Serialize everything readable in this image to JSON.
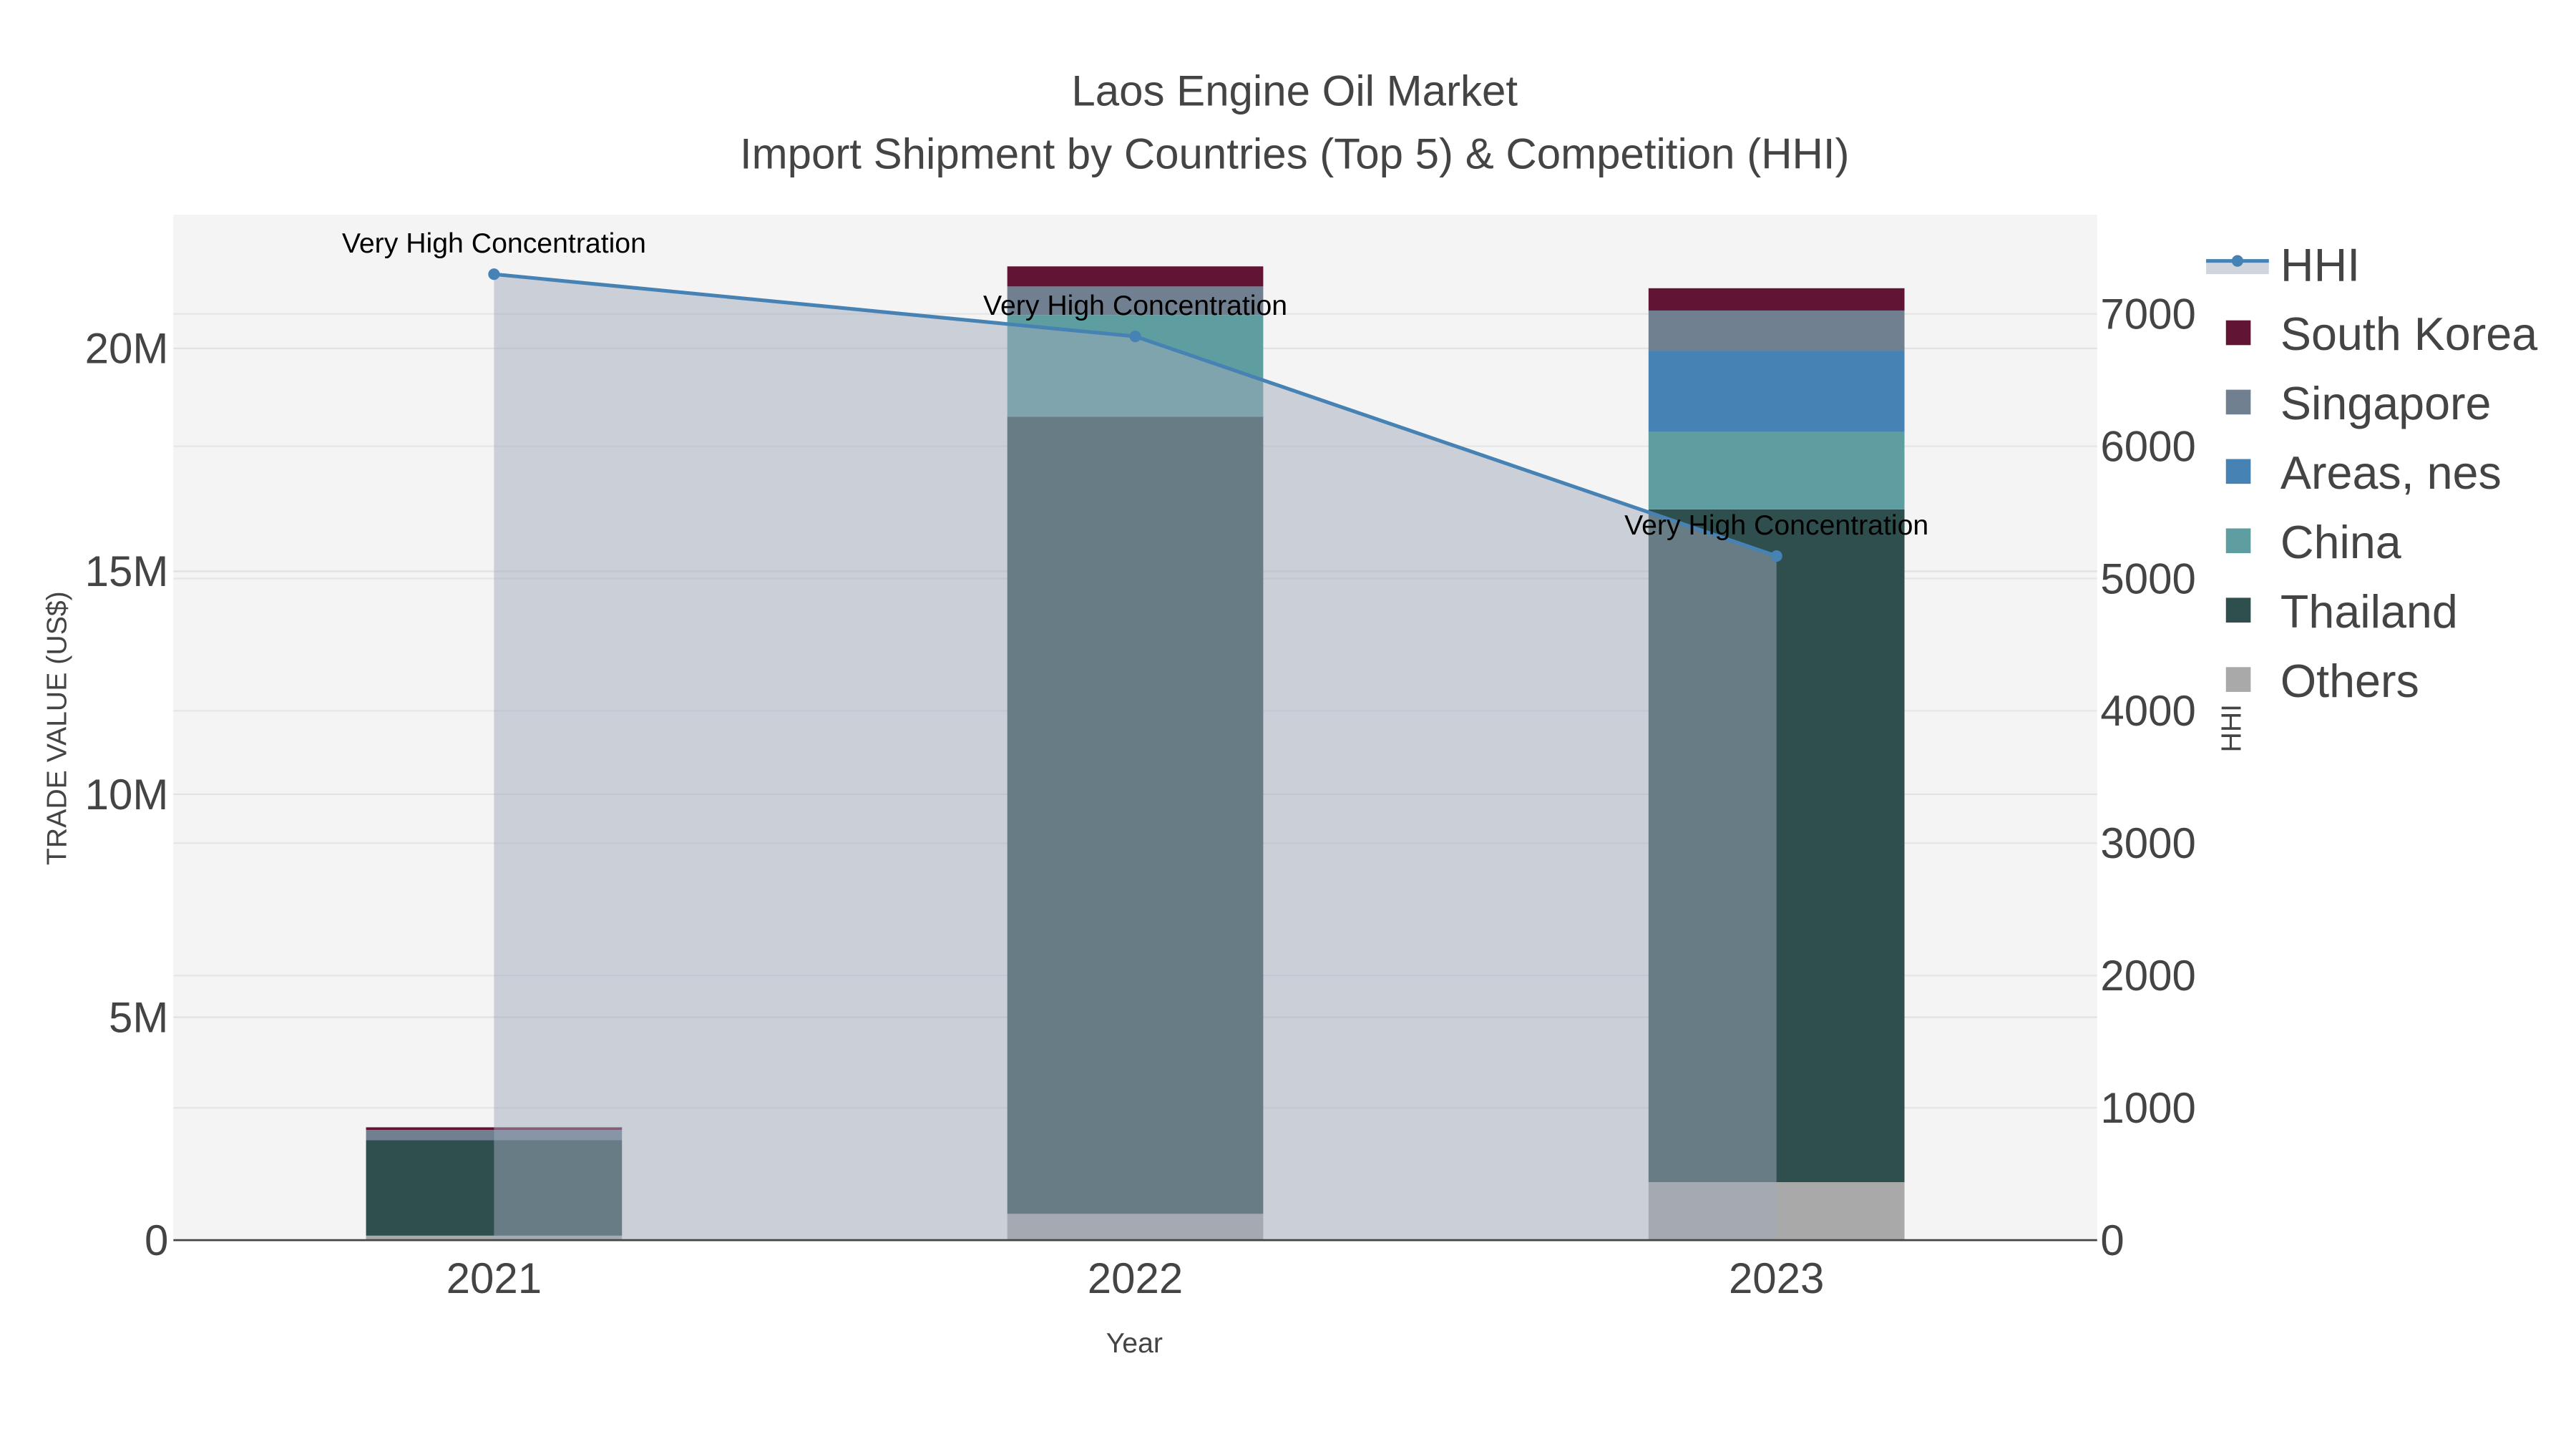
{
  "chart_data": {
    "type": "bar",
    "stacked": true,
    "title": "Laos Engine Oil Market",
    "subtitle": "Import Shipment by Countries (Top 5) & Competition (HHI)",
    "xlabel": "Year",
    "ylabel": "TRADE VALUE (US$)",
    "y2label": "HHI",
    "categories": [
      "2021",
      "2022",
      "2023"
    ],
    "ylim": [
      0,
      23000000
    ],
    "y2lim": [
      0,
      7750
    ],
    "yticks": [
      {
        "v": 0,
        "label": "0"
      },
      {
        "v": 5000000,
        "label": "5M"
      },
      {
        "v": 10000000,
        "label": "10M"
      },
      {
        "v": 15000000,
        "label": "15M"
      },
      {
        "v": 20000000,
        "label": "20M"
      }
    ],
    "y2ticks": [
      {
        "v": 0,
        "label": "0"
      },
      {
        "v": 1000,
        "label": "1000"
      },
      {
        "v": 2000,
        "label": "2000"
      },
      {
        "v": 3000,
        "label": "3000"
      },
      {
        "v": 4000,
        "label": "4000"
      },
      {
        "v": 5000,
        "label": "5000"
      },
      {
        "v": 6000,
        "label": "6000"
      },
      {
        "v": 7000,
        "label": "7000"
      }
    ],
    "series": [
      {
        "name": "Others",
        "color": "#A9A9A9",
        "values": [
          100000,
          590000,
          1300000
        ]
      },
      {
        "name": "Thailand",
        "color": "#2F4F4F",
        "values": [
          2140000,
          17880000,
          15090000
        ]
      },
      {
        "name": "China",
        "color": "#5F9EA0",
        "values": [
          0,
          2280000,
          1740000
        ]
      },
      {
        "name": "Areas, nes",
        "color": "#4682B4",
        "values": [
          0,
          0,
          1820000
        ]
      },
      {
        "name": "Singapore",
        "color": "#708090",
        "values": [
          230000,
          640000,
          900000
        ]
      },
      {
        "name": "South Korea",
        "color": "#621435",
        "values": [
          60000,
          450000,
          500000
        ]
      }
    ],
    "hhi": {
      "name": "HHI",
      "color": "#4682B4",
      "values": [
        7300,
        6830,
        5170
      ],
      "labels": [
        "Very High Concentration",
        "Very High Concentration",
        "Very High Concentration"
      ]
    },
    "legend": {
      "placement": "right",
      "order": [
        "HHI",
        "South Korea",
        "Singapore",
        "Areas, nes",
        "China",
        "Thailand",
        "Others"
      ]
    },
    "grid": true
  }
}
